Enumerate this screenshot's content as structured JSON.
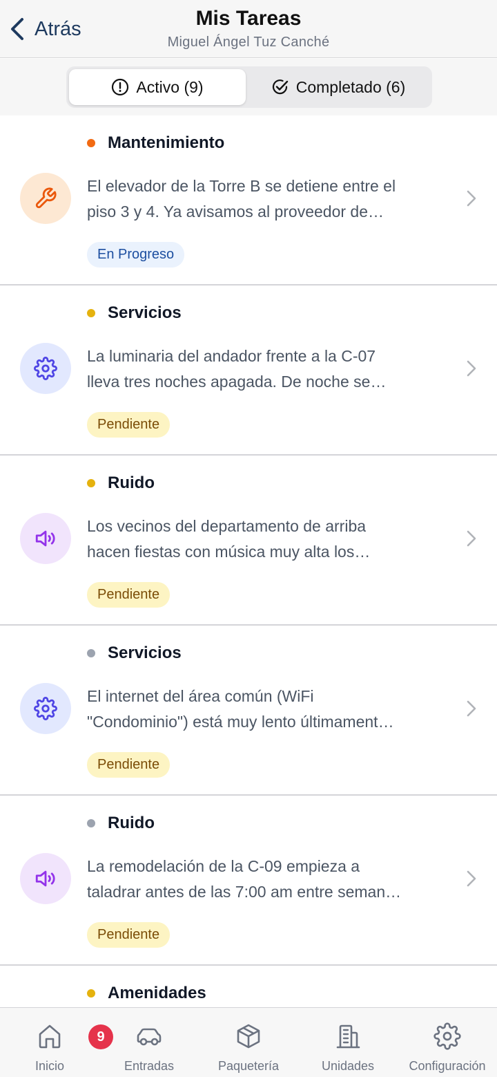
{
  "header": {
    "back_label": "Atrás",
    "title": "Mis Tareas",
    "subtitle": "Miguel Ángel Tuz Canché"
  },
  "segments": {
    "active_label": "Activo (9)",
    "completed_label": "Completado (6)"
  },
  "tasks": [
    {
      "category": "Mantenimiento",
      "dot_color": "#f26a12",
      "icon": "wrench-icon",
      "line1": "El elevador de la Torre B se detiene entre el",
      "line2": "piso 3 y 4. Ya avisamos al proveedor de…",
      "status": "En Progreso"
    },
    {
      "category": "Servicios",
      "dot_color": "#e5b20e",
      "icon": "gear-icon",
      "line1": "La luminaria del andador frente a la C-07",
      "line2": "lleva tres noches apagada. De noche se…",
      "status": "Pendiente"
    },
    {
      "category": "Ruido",
      "dot_color": "#e5b20e",
      "icon": "speaker-icon",
      "line1": "Los vecinos del departamento de arriba",
      "line2": "hacen fiestas con música muy alta los…",
      "status": "Pendiente"
    },
    {
      "category": "Servicios",
      "dot_color": "#9ca3af",
      "icon": "gear-icon",
      "line1": "El internet del área común (WiFi",
      "line2": "\"Condominio\") está muy lento últimament…",
      "status": "Pendiente"
    },
    {
      "category": "Ruido",
      "dot_color": "#9ca3af",
      "icon": "speaker-icon",
      "line1": "La remodelación de la C-09 empieza a",
      "line2": "taladrar antes de las 7:00 am entre seman…",
      "status": "Pendiente"
    }
  ],
  "partial_task": {
    "category": "Amenidades",
    "dot_color": "#e5b20e"
  },
  "tabbar": {
    "inicio": "Inicio",
    "entradas": "Entradas",
    "entradas_badge": "9",
    "paqueteria": "Paquetería",
    "unidades": "Unidades",
    "configuracion": "Configuración"
  },
  "colors": {
    "accent_dark": "#1e3a5f",
    "wrench_bg": "#fde8d3",
    "wrench_fg": "#ea580c",
    "gear_bg": "#e2e8fe",
    "gear_fg": "#4f46e5",
    "speaker_bg": "#f1e4fc",
    "speaker_fg": "#9333ea",
    "badge_red": "#e5334b"
  }
}
